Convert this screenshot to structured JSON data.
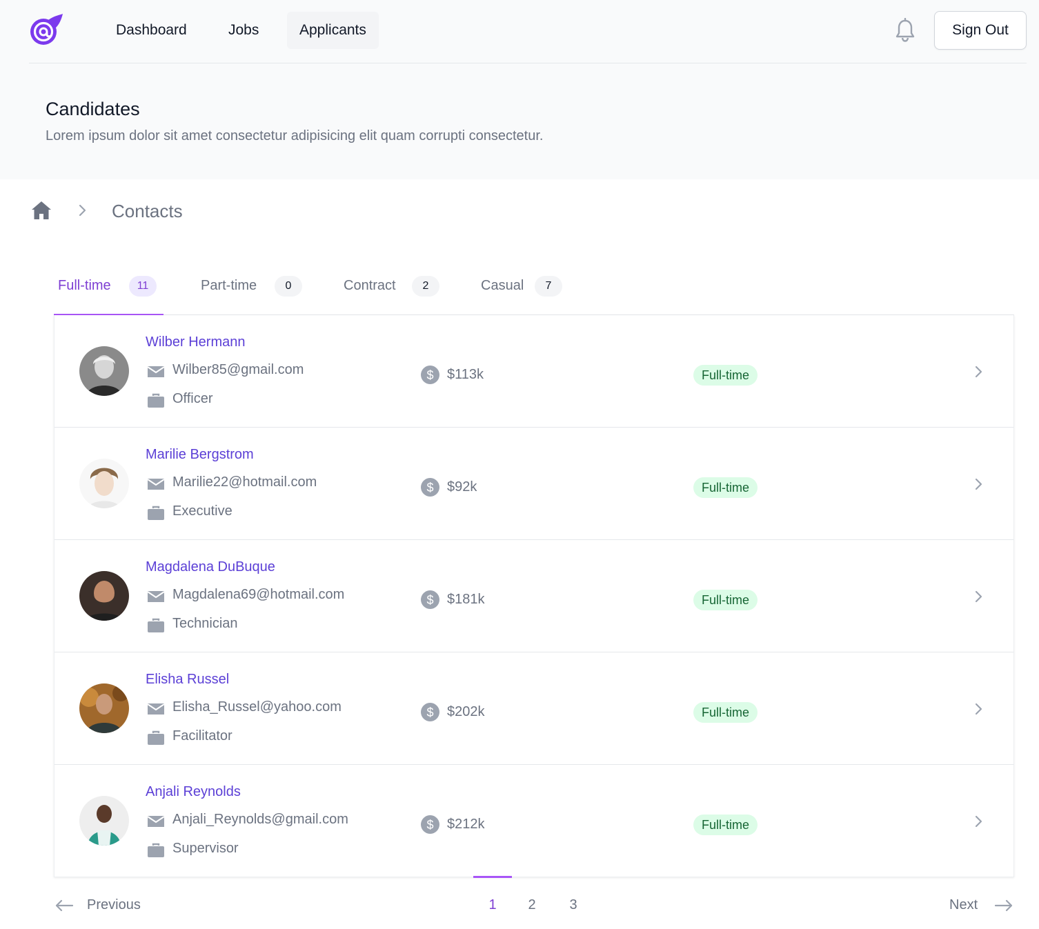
{
  "nav": {
    "links": [
      "Dashboard",
      "Jobs",
      "Applicants"
    ],
    "active": "Applicants",
    "sign_out": "Sign Out",
    "icons": {
      "logo": "at-sign-logo",
      "notifications": "bell-icon"
    }
  },
  "header": {
    "title": "Candidates",
    "subtitle": "Lorem ipsum dolor sit amet consectetur adipisicing elit quam corrupti consectetur."
  },
  "breadcrumb": {
    "home_icon": "home-icon",
    "current": "Contacts"
  },
  "tabs": [
    {
      "label": "Full-time",
      "count": "11",
      "active": true
    },
    {
      "label": "Part-time",
      "count": "0",
      "active": false
    },
    {
      "label": "Contract",
      "count": "2",
      "active": false
    },
    {
      "label": "Casual",
      "count": "7",
      "active": false
    }
  ],
  "candidates": [
    {
      "name": "Wilber Hermann",
      "email": "Wilber85@gmail.com",
      "role": "Officer",
      "salary": "$113k",
      "type": "Full-time"
    },
    {
      "name": "Marilie Bergstrom",
      "email": "Marilie22@hotmail.com",
      "role": "Executive",
      "salary": "$92k",
      "type": "Full-time"
    },
    {
      "name": "Magdalena DuBuque",
      "email": "Magdalena69@hotmail.com",
      "role": "Technician",
      "salary": "$181k",
      "type": "Full-time"
    },
    {
      "name": "Elisha Russel",
      "email": "Elisha_Russel@yahoo.com",
      "role": "Facilitator",
      "salary": "$202k",
      "type": "Full-time"
    },
    {
      "name": "Anjali Reynolds",
      "email": "Anjali_Reynolds@gmail.com",
      "role": "Supervisor",
      "salary": "$212k",
      "type": "Full-time"
    }
  ],
  "pagination": {
    "previous": "Previous",
    "next": "Next",
    "pages": [
      "1",
      "2",
      "3"
    ],
    "current": "1"
  },
  "colors": {
    "accent": "#a855f7",
    "accent_text": "#7e3fd3",
    "name_link": "#5b3fd6",
    "badge_bg": "#dcfce7",
    "badge_text": "#166534"
  }
}
